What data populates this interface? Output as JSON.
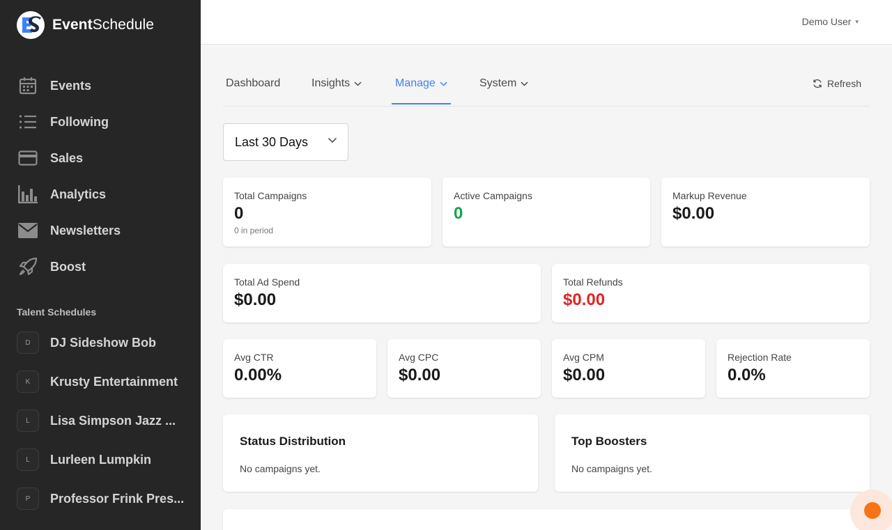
{
  "brand": {
    "name_bold": "Event",
    "name_regular": "Schedule",
    "logo_text": "ES"
  },
  "sidebar": {
    "items": [
      {
        "label": "Events",
        "icon": "calendar-icon"
      },
      {
        "label": "Following",
        "icon": "list-icon"
      },
      {
        "label": "Sales",
        "icon": "credit-card-icon"
      },
      {
        "label": "Analytics",
        "icon": "bar-chart-icon"
      },
      {
        "label": "Newsletters",
        "icon": "envelope-icon"
      },
      {
        "label": "Boost",
        "icon": "rocket-icon"
      }
    ],
    "section_title": "Talent Schedules",
    "talent": [
      {
        "initial": "D",
        "label": "DJ Sideshow Bob"
      },
      {
        "initial": "K",
        "label": "Krusty Entertainment"
      },
      {
        "initial": "L",
        "label": "Lisa Simpson Jazz ..."
      },
      {
        "initial": "L",
        "label": "Lurleen Lumpkin"
      },
      {
        "initial": "P",
        "label": "Professor Frink Pres..."
      }
    ]
  },
  "header": {
    "user": "Demo User"
  },
  "tabs": [
    {
      "label": "Dashboard"
    },
    {
      "label": "Insights"
    },
    {
      "label": "Manage"
    },
    {
      "label": "System"
    }
  ],
  "refresh_label": "Refresh",
  "range": {
    "selected": "Last 30 Days"
  },
  "stats": {
    "total_campaigns": {
      "label": "Total Campaigns",
      "value": "0",
      "sub": "0 in period"
    },
    "active_campaigns": {
      "label": "Active Campaigns",
      "value": "0"
    },
    "markup_revenue": {
      "label": "Markup Revenue",
      "value": "$0.00"
    },
    "total_ad_spend": {
      "label": "Total Ad Spend",
      "value": "$0.00"
    },
    "total_refunds": {
      "label": "Total Refunds",
      "value": "$0.00"
    },
    "avg_ctr": {
      "label": "Avg CTR",
      "value": "0.00%"
    },
    "avg_cpc": {
      "label": "Avg CPC",
      "value": "$0.00"
    },
    "avg_cpm": {
      "label": "Avg CPM",
      "value": "$0.00"
    },
    "rejection_rate": {
      "label": "Rejection Rate",
      "value": "0.0%"
    }
  },
  "panels": {
    "status_distribution": {
      "title": "Status Distribution",
      "empty": "No campaigns yet."
    },
    "top_boosters": {
      "title": "Top Boosters",
      "empty": "No campaigns yet."
    }
  },
  "colors": {
    "accent": "#3b82f6",
    "positive": "#16a34a",
    "negative": "#dc2626",
    "sidebar_bg": "#262626",
    "chat": "#f97316"
  }
}
